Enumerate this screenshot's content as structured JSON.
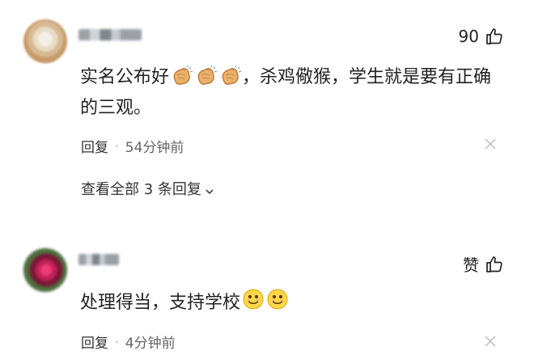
{
  "comments": [
    {
      "likes": "90",
      "text_prefix": "实名公布好",
      "text_suffix": "，杀鸡儆猴，学生就是要有正确的三观。",
      "time": "54分钟前",
      "reply_label": "回复",
      "separator": "·",
      "view_replies": "查看全部 3 条回复"
    },
    {
      "likes": "赞",
      "text_prefix": "处理得当，支持学校",
      "text_suffix": "",
      "time": "4分钟前",
      "reply_label": "回复",
      "separator": "·"
    }
  ],
  "icons": {
    "like": "thumb-up-icon",
    "close": "close-icon",
    "expand": "chevron-down-icon",
    "clap": "clapping-hands-emoji",
    "smile": "smiling-face-emoji"
  }
}
